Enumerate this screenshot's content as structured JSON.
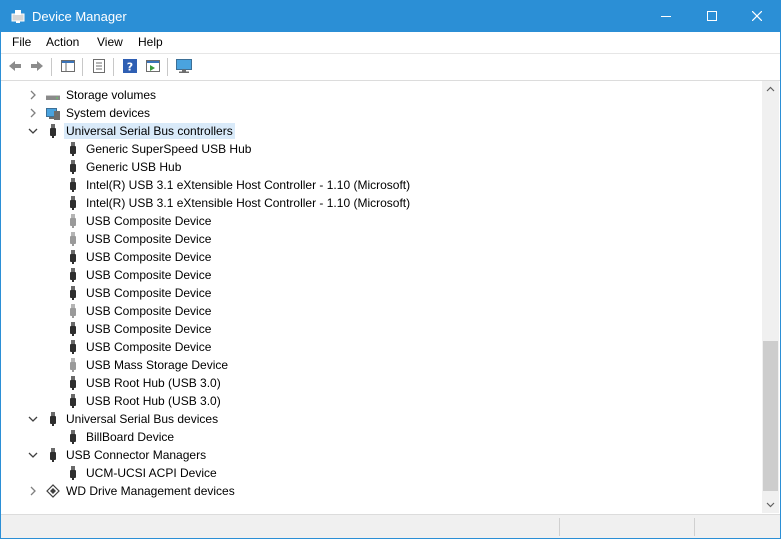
{
  "window": {
    "title": "Device Manager",
    "title_icon": "device-manager-icon",
    "controls": [
      "minimize-icon",
      "maximize-icon",
      "close-icon"
    ]
  },
  "menu": {
    "items": [
      {
        "label": "File"
      },
      {
        "label": "Action"
      },
      {
        "label": "View"
      },
      {
        "label": "Help"
      }
    ]
  },
  "toolbar": {
    "buttons": [
      "back-icon",
      "forward-icon",
      "show-hide-console-tree-icon",
      "properties-icon",
      "help-icon",
      "run-action-icon",
      "monitor-icon"
    ]
  },
  "tree": {
    "rows": [
      {
        "label": "Storage volumes",
        "level": 0,
        "expander": "collapsed",
        "icon": "storage-volume-icon"
      },
      {
        "label": "System devices",
        "level": 0,
        "expander": "collapsed",
        "icon": "system-devices-icon"
      },
      {
        "label": "Universal Serial Bus controllers",
        "level": 0,
        "expander": "expanded",
        "icon": "usb-icon",
        "selected": true
      },
      {
        "label": "Generic SuperSpeed USB Hub",
        "level": 1,
        "icon": "usb-icon"
      },
      {
        "label": "Generic USB Hub",
        "level": 1,
        "icon": "usb-icon"
      },
      {
        "label": "Intel(R) USB 3.1 eXtensible Host Controller - 1.10 (Microsoft)",
        "level": 1,
        "icon": "usb-icon"
      },
      {
        "label": "Intel(R) USB 3.1 eXtensible Host Controller - 1.10 (Microsoft)",
        "level": 1,
        "icon": "usb-icon"
      },
      {
        "label": "USB Composite Device",
        "level": 1,
        "icon": "usb-icon",
        "faded": true
      },
      {
        "label": "USB Composite Device",
        "level": 1,
        "icon": "usb-icon",
        "faded": true
      },
      {
        "label": "USB Composite Device",
        "level": 1,
        "icon": "usb-icon"
      },
      {
        "label": "USB Composite Device",
        "level": 1,
        "icon": "usb-icon"
      },
      {
        "label": "USB Composite Device",
        "level": 1,
        "icon": "usb-icon"
      },
      {
        "label": "USB Composite Device",
        "level": 1,
        "icon": "usb-icon",
        "faded": true
      },
      {
        "label": "USB Composite Device",
        "level": 1,
        "icon": "usb-icon"
      },
      {
        "label": "USB Composite Device",
        "level": 1,
        "icon": "usb-icon"
      },
      {
        "label": "USB Mass Storage Device",
        "level": 1,
        "icon": "usb-icon",
        "faded": true
      },
      {
        "label": "USB Root Hub (USB 3.0)",
        "level": 1,
        "icon": "usb-icon"
      },
      {
        "label": "USB Root Hub (USB 3.0)",
        "level": 1,
        "icon": "usb-icon"
      },
      {
        "label": "Universal Serial Bus devices",
        "level": 0,
        "expander": "expanded",
        "icon": "usb-icon"
      },
      {
        "label": "BillBoard Device",
        "level": 1,
        "icon": "usb-icon"
      },
      {
        "label": "USB Connector Managers",
        "level": 0,
        "expander": "expanded",
        "icon": "usb-icon"
      },
      {
        "label": "UCM-UCSI ACPI Device",
        "level": 1,
        "icon": "usb-icon"
      },
      {
        "label": "WD Drive Management devices",
        "level": 0,
        "expander": "collapsed",
        "icon": "wd-drive-icon"
      }
    ]
  },
  "colors": {
    "titlebar": "#2b8fd6",
    "selection": "#d9eaf9"
  }
}
